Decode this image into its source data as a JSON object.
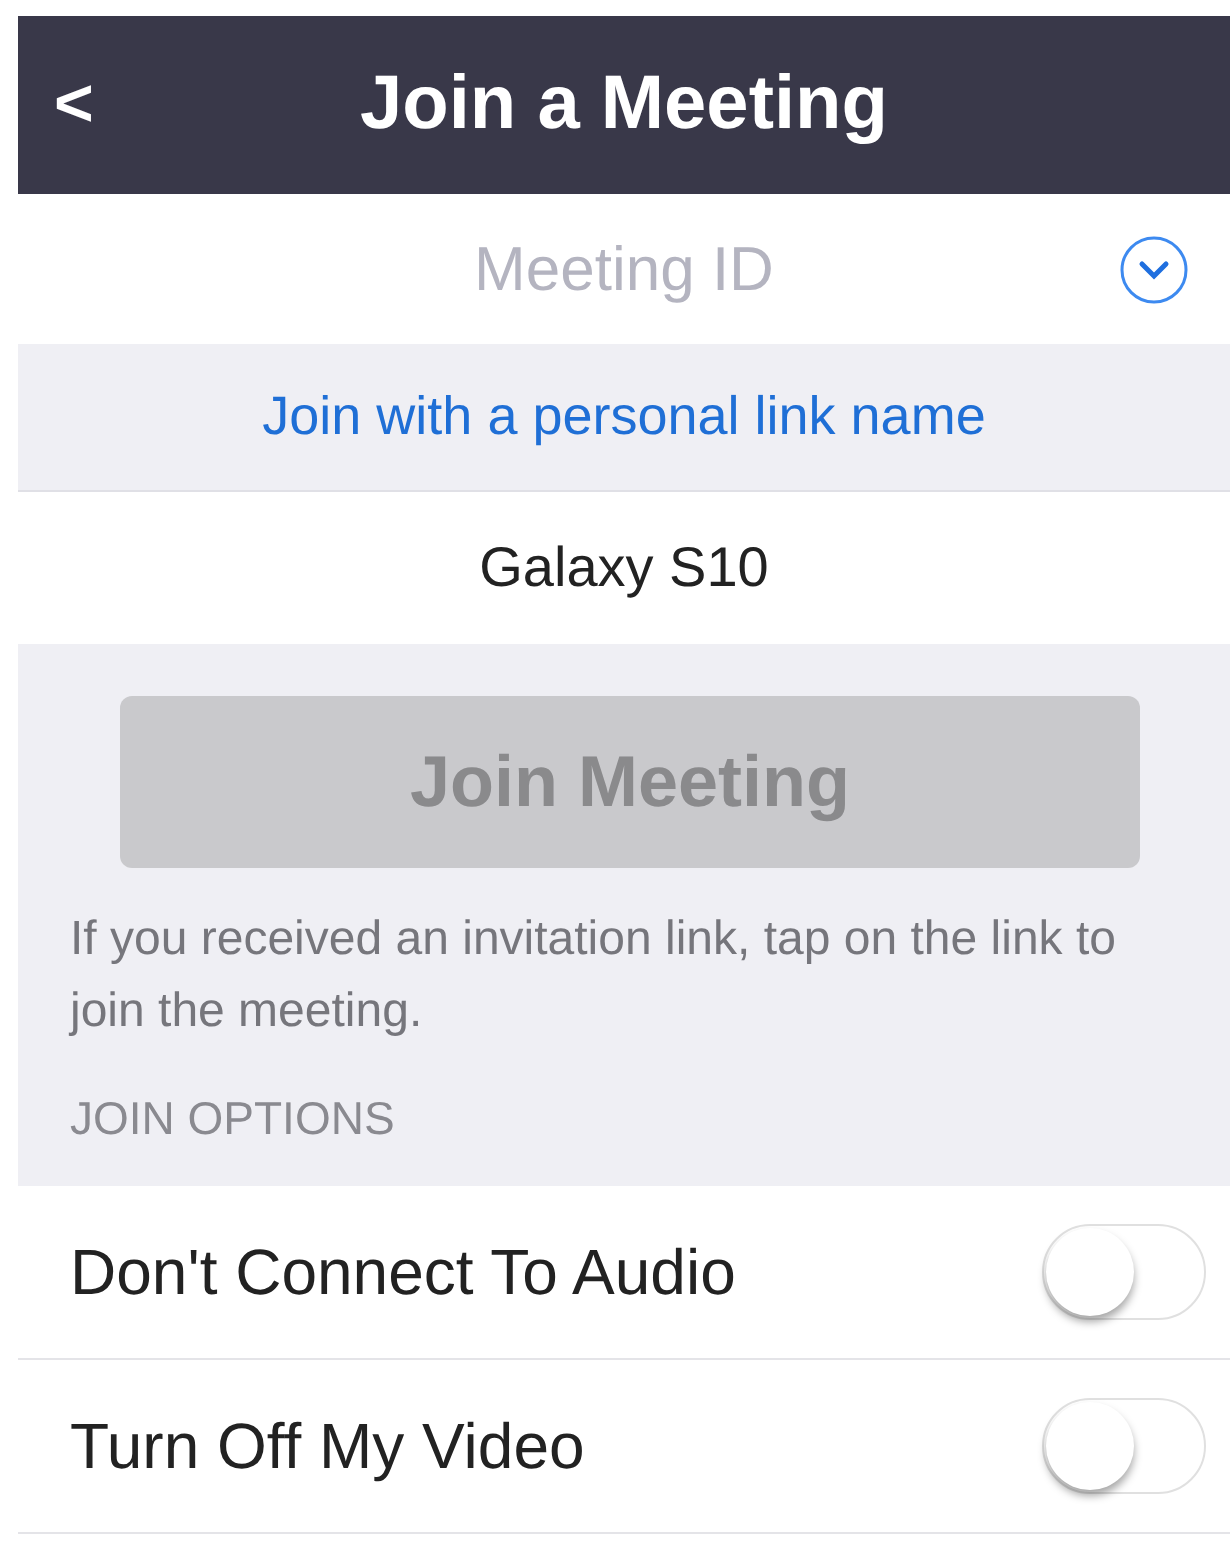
{
  "header": {
    "back": "<",
    "title": "Join a Meeting"
  },
  "meeting_id": {
    "placeholder": "Meeting ID"
  },
  "personal_link": "Join with a personal link name",
  "name_field": {
    "value": "Galaxy S10"
  },
  "join_button": {
    "label": "Join Meeting",
    "disabled": true
  },
  "help_text": "If you received an invitation link, tap on the link to join the meeting.",
  "options_heading": "JOIN OPTIONS",
  "options": [
    {
      "label": "Don't Connect To Audio",
      "on": false
    },
    {
      "label": "Turn Off My Video",
      "on": false
    }
  ]
}
